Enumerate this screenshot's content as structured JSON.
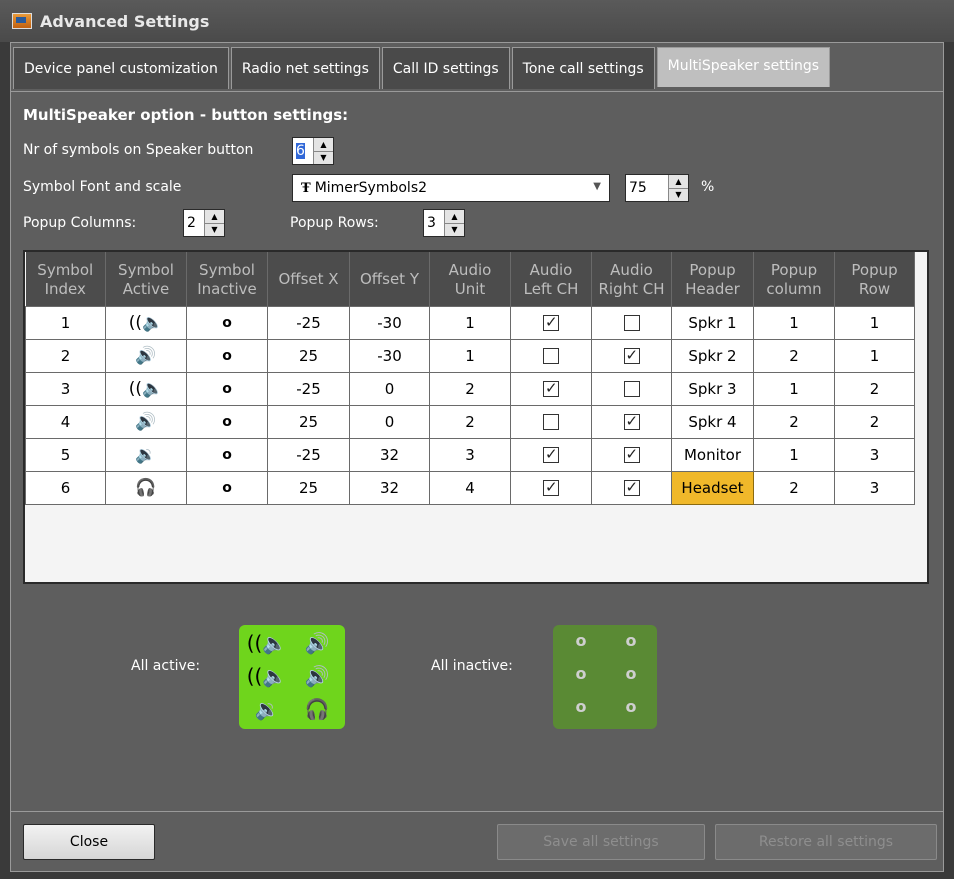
{
  "window": {
    "title": "Advanced Settings"
  },
  "tabs": [
    {
      "label": "Device panel customization"
    },
    {
      "label": "Radio net settings"
    },
    {
      "label": "Call ID settings"
    },
    {
      "label": "Tone call settings"
    },
    {
      "label": "MultiSpeaker settings"
    }
  ],
  "settings": {
    "section_title": "MultiSpeaker option - button settings:",
    "nr_symbols_label": "Nr of symbols on Speaker button",
    "nr_symbols_value": "6",
    "font_label": "Symbol Font and scale",
    "font_glyph": "Ŧ",
    "font_value": "MimerSymbols2",
    "scale_value": "75",
    "scale_unit": "%",
    "popup_columns_label": "Popup Columns:",
    "popup_columns_value": "2",
    "popup_rows_label": "Popup Rows:",
    "popup_rows_value": "3"
  },
  "table": {
    "headers": [
      [
        "Symbol",
        "Index"
      ],
      [
        "Symbol",
        "Active"
      ],
      [
        "Symbol",
        "Inactive"
      ],
      [
        "Offset X",
        ""
      ],
      [
        "Offset Y",
        ""
      ],
      [
        "Audio",
        "Unit"
      ],
      [
        "Audio",
        "Left CH"
      ],
      [
        "Audio",
        "Right CH"
      ],
      [
        "Popup",
        "Header"
      ],
      [
        "Popup",
        "column"
      ],
      [
        "Popup",
        "Row"
      ]
    ],
    "rows": [
      {
        "index": "1",
        "active": "((🔈",
        "inactive": "o",
        "ox": "-25",
        "oy": "-30",
        "unit": "1",
        "left": true,
        "right": false,
        "header": "Spkr 1",
        "col": "1",
        "row": "1"
      },
      {
        "index": "2",
        "active": "🔊",
        "inactive": "o",
        "ox": "25",
        "oy": "-30",
        "unit": "1",
        "left": false,
        "right": true,
        "header": "Spkr 2",
        "col": "2",
        "row": "1"
      },
      {
        "index": "3",
        "active": "((🔈",
        "inactive": "o",
        "ox": "-25",
        "oy": "0",
        "unit": "2",
        "left": true,
        "right": false,
        "header": "Spkr 3",
        "col": "1",
        "row": "2"
      },
      {
        "index": "4",
        "active": "🔊",
        "inactive": "o",
        "ox": "25",
        "oy": "0",
        "unit": "2",
        "left": false,
        "right": true,
        "header": "Spkr 4",
        "col": "2",
        "row": "2"
      },
      {
        "index": "5",
        "active": "🔉",
        "inactive": "o",
        "ox": "-25",
        "oy": "32",
        "unit": "3",
        "left": true,
        "right": true,
        "header": "Monitor",
        "col": "1",
        "row": "3"
      },
      {
        "index": "6",
        "active": "🎧",
        "inactive": "o",
        "ox": "25",
        "oy": "32",
        "unit": "4",
        "left": true,
        "right": true,
        "header": "Headset",
        "col": "2",
        "row": "3"
      }
    ]
  },
  "preview": {
    "all_active_label": "All active:",
    "all_inactive_label": "All inactive:",
    "active_symbols": [
      "((🔈",
      "🔊",
      "((🔈",
      "🔊",
      "🔉",
      "🎧"
    ],
    "inactive_symbols": [
      "o",
      "o",
      "o",
      "o",
      "o",
      "o"
    ]
  },
  "footer": {
    "close_label": "Close",
    "save_label": "Save all settings",
    "restore_label": "Restore all settings"
  }
}
